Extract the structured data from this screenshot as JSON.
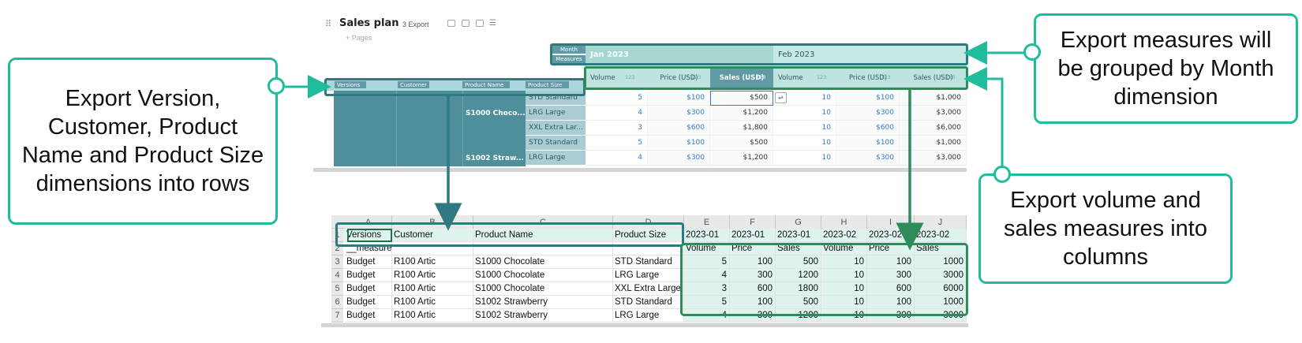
{
  "header": {
    "title": "Sales plan",
    "separator": "·",
    "export_label": "3 Export",
    "pages_label": "+ Pages",
    "icons": [
      "drag-handle-icon",
      "comment-icon",
      "filter-icon",
      "sort-icon",
      "menu-icon"
    ]
  },
  "app_grid": {
    "month_label": "Month",
    "measures_label": "Measures",
    "months": [
      "Jan 2023",
      "Feb 2023"
    ],
    "row_headers": [
      "Versions",
      "Customer",
      "Product Name",
      "Product Size"
    ],
    "measure_cols": [
      {
        "name": "Volume",
        "type": "123"
      },
      {
        "name": "Price (USD)",
        "type": "123"
      },
      {
        "name": "Sales (USD)",
        "type": "123"
      },
      {
        "name": "Volume",
        "type": "123"
      },
      {
        "name": "Price (USD)",
        "type": "123"
      },
      {
        "name": "Sales (USD)",
        "type": "123"
      }
    ],
    "rows": [
      {
        "product": "",
        "size": "STD Standard",
        "values": [
          "5",
          "$100",
          "$500",
          "10",
          "$100",
          "$1,000"
        ]
      },
      {
        "product": "S1000 Choco...",
        "size": "LRG Large",
        "values": [
          "4",
          "$300",
          "$1,200",
          "10",
          "$300",
          "$3,000"
        ]
      },
      {
        "product": "",
        "size": "XXL Extra Lar...",
        "values": [
          "3",
          "$600",
          "$1,800",
          "10",
          "$600",
          "$6,000"
        ]
      },
      {
        "product": "",
        "size": "STD Standard",
        "values": [
          "5",
          "$100",
          "$500",
          "10",
          "$100",
          "$1,000"
        ]
      },
      {
        "product": "S1002 Straw...",
        "size": "LRG Large",
        "values": [
          "4",
          "$300",
          "$1,200",
          "10",
          "$300",
          "$3,000"
        ]
      }
    ]
  },
  "excel": {
    "col_letters": [
      "A",
      "B",
      "C",
      "D",
      "E",
      "F",
      "G",
      "H",
      "I",
      "J"
    ],
    "row_numbers": [
      "1",
      "2",
      "3",
      "4",
      "5",
      "6",
      "7"
    ],
    "row1": [
      "Versions",
      "Customer",
      "Product Name",
      "Product Size",
      "2023-01",
      "2023-01",
      "2023-01",
      "2023-02",
      "2023-02",
      "2023-02"
    ],
    "row2": [
      "__measure",
      "",
      "",
      "",
      "Volume",
      "Price",
      "Sales",
      "Volume",
      "Price",
      "Sales"
    ],
    "data": [
      [
        "Budget",
        "R100 Artic",
        "S1000 Chocolate",
        "STD Standard",
        "5",
        "100",
        "500",
        "10",
        "100",
        "1000"
      ],
      [
        "Budget",
        "R100 Artic",
        "S1000 Chocolate",
        "LRG Large",
        "4",
        "300",
        "1200",
        "10",
        "300",
        "3000"
      ],
      [
        "Budget",
        "R100 Artic",
        "S1000 Chocolate",
        "XXL Extra Large",
        "3",
        "600",
        "1800",
        "10",
        "600",
        "6000"
      ],
      [
        "Budget",
        "R100 Artic",
        "S1002 Strawberry",
        "STD Standard",
        "5",
        "100",
        "500",
        "10",
        "100",
        "1000"
      ],
      [
        "Budget",
        "R100 Artic",
        "S1002 Strawberry",
        "LRG Large",
        "4",
        "300",
        "1200",
        "10",
        "300",
        "3000"
      ]
    ]
  },
  "callouts": {
    "rows": "Export Version, Customer, Product Name and Product Size dimensions into rows",
    "months": "Export measures will be grouped by Month dimension",
    "columns": "Export volume and sales measures into columns"
  },
  "colors": {
    "callout_border": "#1fbd9c",
    "highlight_dark": "#2f7a80",
    "highlight_green": "#2e8b5a",
    "row_header_fill": "#5f9aa5",
    "measure_fill": "#bfe3de"
  }
}
